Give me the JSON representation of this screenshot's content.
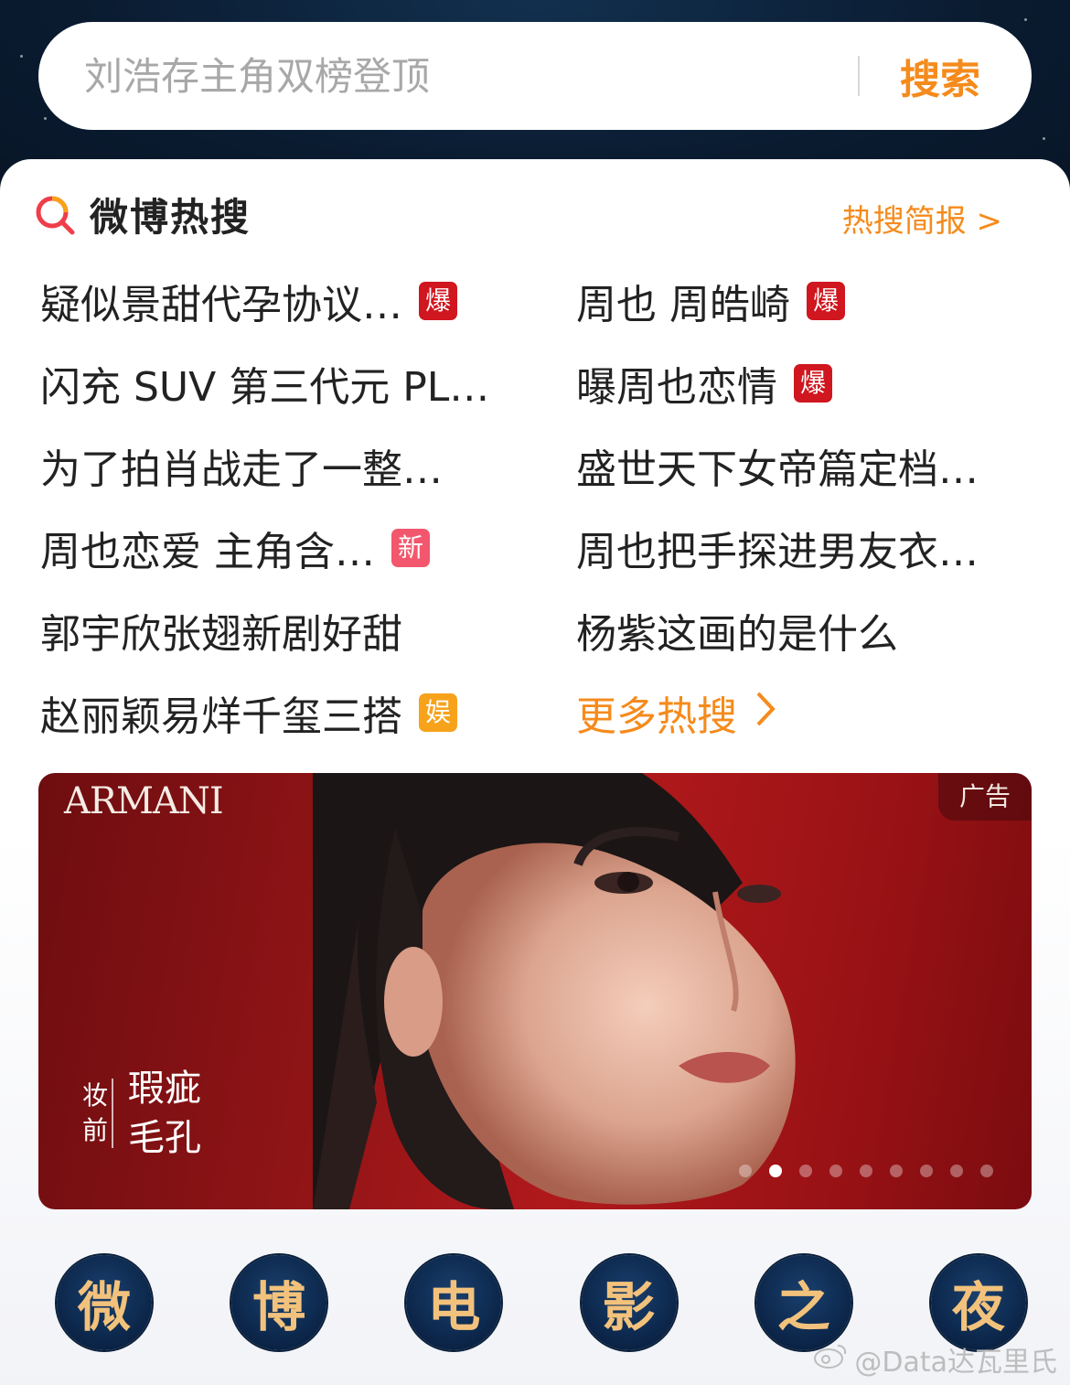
{
  "search": {
    "placeholder": "刘浩存主角双榜登顶",
    "button_label": "搜索"
  },
  "hot_search": {
    "title": "微博热搜",
    "report_link": "热搜简报 >",
    "items": [
      {
        "text": "疑似景甜代孕协议…",
        "badge": "爆",
        "badge_color": "#d0161e"
      },
      {
        "text": "周也 周皓崎",
        "badge": "爆",
        "badge_color": "#d0161e"
      },
      {
        "text": "闪充 SUV 第三代元 PL…",
        "badge": "",
        "badge_color": ""
      },
      {
        "text": "曝周也恋情",
        "badge": "爆",
        "badge_color": "#d0161e"
      },
      {
        "text": "为了拍肖战走了一整…",
        "badge": "",
        "badge_color": ""
      },
      {
        "text": "盛世天下女帝篇定档…",
        "badge": "",
        "badge_color": ""
      },
      {
        "text": "周也恋爱 主角含…",
        "badge": "新",
        "badge_color": "#f2576d"
      },
      {
        "text": "周也把手探进男友衣…",
        "badge": "",
        "badge_color": ""
      },
      {
        "text": "郭宇欣张翅新剧好甜",
        "badge": "",
        "badge_color": ""
      },
      {
        "text": "杨紫这画的是什么",
        "badge": "",
        "badge_color": ""
      },
      {
        "text": "赵丽颖易烊千玺三搭",
        "badge": "娱",
        "badge_color": "#f7a21b"
      }
    ],
    "more_label": "更多热搜",
    "more_chevron": "chevron-right-icon",
    "accent_color": "#f58b1c"
  },
  "ad": {
    "brand": "ARMANI",
    "tag": "广告",
    "side_small": "妆前",
    "side_big_line1": "瑕疵",
    "side_big_line2": "毛孔",
    "carousel_count": 9,
    "carousel_active": 1
  },
  "event": {
    "chars": [
      "微",
      "博",
      "电",
      "影",
      "之",
      "夜"
    ]
  },
  "watermark": "@Data达瓦里氏"
}
